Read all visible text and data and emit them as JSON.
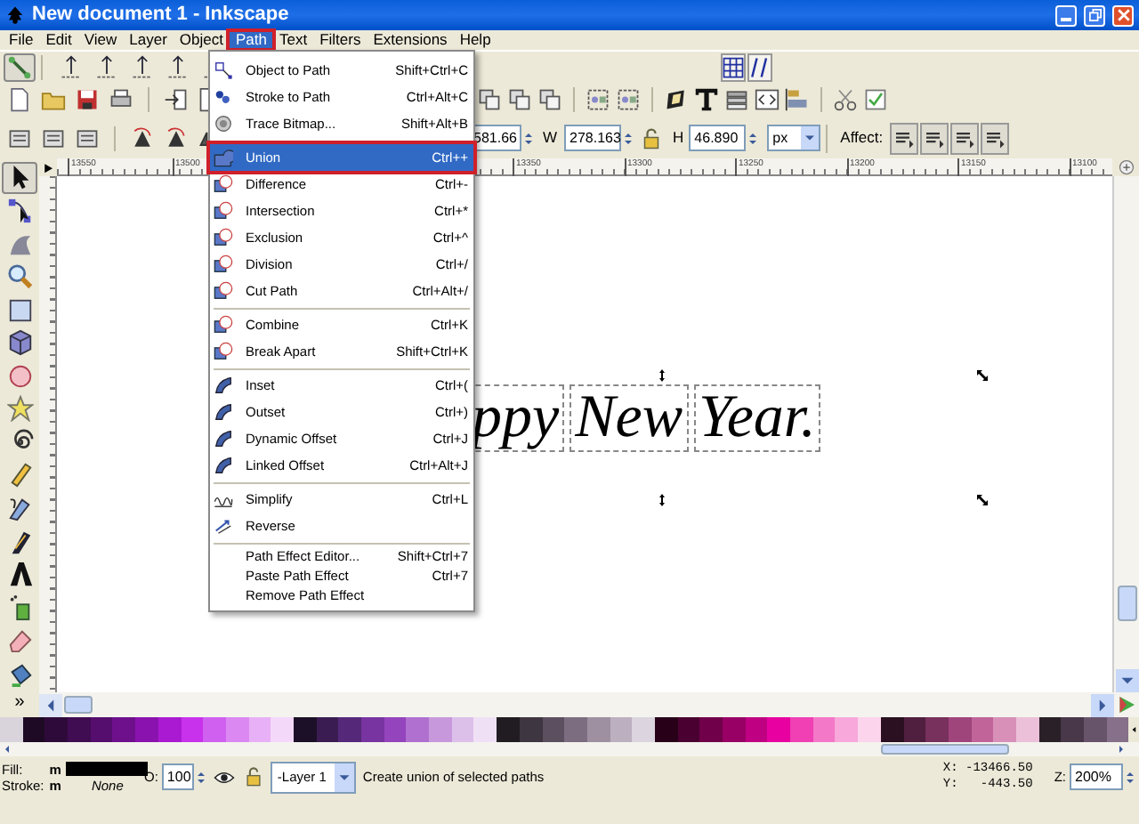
{
  "window": {
    "title": "New document 1 - Inkscape"
  },
  "menubar": [
    {
      "label": "File",
      "selected": false
    },
    {
      "label": "Edit",
      "selected": false
    },
    {
      "label": "View",
      "selected": false
    },
    {
      "label": "Layer",
      "selected": false
    },
    {
      "label": "Object",
      "selected": false
    },
    {
      "label": "Path",
      "selected": true
    },
    {
      "label": "Text",
      "selected": false
    },
    {
      "label": "Filters",
      "selected": false
    },
    {
      "label": "Extensions",
      "selected": false
    },
    {
      "label": "Help",
      "selected": false
    }
  ],
  "snap_toolbar": {
    "snap_enabled": true
  },
  "tool_controls": {
    "x_value": "581.66",
    "w_label": "W",
    "w_value": "278.163",
    "h_label": "H",
    "h_value": "46.890",
    "unit": "px",
    "affect_label": "Affect:"
  },
  "toolbox": [
    {
      "selected": true
    },
    {
      "selected": false
    },
    {
      "selected": false
    },
    {
      "selected": false
    },
    {
      "selected": false
    },
    {
      "selected": false
    },
    {
      "selected": false
    },
    {
      "selected": false
    },
    {
      "selected": false
    },
    {
      "selected": false
    },
    {
      "selected": false
    },
    {
      "selected": false
    },
    {
      "selected": false
    },
    {
      "selected": false
    },
    {
      "selected": false
    },
    {
      "selected": false
    }
  ],
  "toolbox_more": "»",
  "ruler": {
    "labels": [
      "13550",
      "13500",
      "13350",
      "13300",
      "13250",
      "13200",
      "13150",
      "13100"
    ]
  },
  "canvas": {
    "words": [
      "ppy",
      "New",
      "Year."
    ]
  },
  "path_menu": {
    "sections": [
      [
        {
          "label": "Object to Path",
          "shortcut": "Shift+Ctrl+C",
          "selected": false
        },
        {
          "label": "Stroke to Path",
          "shortcut": "Ctrl+Alt+C",
          "selected": false
        },
        {
          "label": "Trace Bitmap...",
          "shortcut": "Shift+Alt+B",
          "selected": false
        }
      ],
      [
        {
          "label": "Union",
          "shortcut": "Ctrl++",
          "selected": true
        },
        {
          "label": "Difference",
          "shortcut": "Ctrl+-",
          "selected": false
        },
        {
          "label": "Intersection",
          "shortcut": "Ctrl+*",
          "selected": false
        },
        {
          "label": "Exclusion",
          "shortcut": "Ctrl+^",
          "selected": false
        },
        {
          "label": "Division",
          "shortcut": "Ctrl+/",
          "selected": false
        },
        {
          "label": "Cut Path",
          "shortcut": "Ctrl+Alt+/",
          "selected": false
        }
      ],
      [
        {
          "label": "Combine",
          "shortcut": "Ctrl+K",
          "selected": false
        },
        {
          "label": "Break Apart",
          "shortcut": "Shift+Ctrl+K",
          "selected": false
        }
      ],
      [
        {
          "label": "Inset",
          "shortcut": "Ctrl+(",
          "selected": false
        },
        {
          "label": "Outset",
          "shortcut": "Ctrl+)",
          "selected": false
        },
        {
          "label": "Dynamic Offset",
          "shortcut": "Ctrl+J",
          "selected": false
        },
        {
          "label": "Linked Offset",
          "shortcut": "Ctrl+Alt+J",
          "selected": false
        }
      ],
      [
        {
          "label": "Simplify",
          "shortcut": "Ctrl+L",
          "selected": false
        },
        {
          "label": "Reverse",
          "selected": false
        }
      ],
      [
        {
          "label": "Path Effect Editor...",
          "shortcut": "Shift+Ctrl+7",
          "selected": false
        },
        {
          "label": "Paste Path Effect",
          "shortcut": "Ctrl+7",
          "selected": false
        },
        {
          "label": "Remove Path Effect",
          "selected": false
        }
      ]
    ]
  },
  "palette": [
    {
      "color": "#d9d3dc"
    },
    {
      "color": "#1e0a24"
    },
    {
      "color": "#2e0a3a"
    },
    {
      "color": "#400c52"
    },
    {
      "color": "#560e6e"
    },
    {
      "color": "#6e108c"
    },
    {
      "color": "#8a12ae"
    },
    {
      "color": "#aa1ad2"
    },
    {
      "color": "#c832ec"
    },
    {
      "color": "#d060f0"
    },
    {
      "color": "#dc88f2"
    },
    {
      "color": "#e8b0f6"
    },
    {
      "color": "#f4d8fa"
    },
    {
      "color": "#1c1028"
    },
    {
      "color": "#3a1c52"
    },
    {
      "color": "#56287a"
    },
    {
      "color": "#7834a0"
    },
    {
      "color": "#9444bc"
    },
    {
      "color": "#b070d0"
    },
    {
      "color": "#c898dc"
    },
    {
      "color": "#dcc0ea"
    },
    {
      "color": "#f0e0f6"
    },
    {
      "color": "#201c22"
    },
    {
      "color": "#3e3640"
    },
    {
      "color": "#5c5060"
    },
    {
      "color": "#7c6e80"
    },
    {
      "color": "#9e90a0"
    },
    {
      "color": "#bcb0c0"
    },
    {
      "color": "#dcd4de"
    },
    {
      "color": "#280018"
    },
    {
      "color": "#4a0030"
    },
    {
      "color": "#70004a"
    },
    {
      "color": "#980066"
    },
    {
      "color": "#c00082"
    },
    {
      "color": "#e800a0"
    },
    {
      "color": "#f040b4"
    },
    {
      "color": "#f478c8"
    },
    {
      "color": "#f8a8da"
    },
    {
      "color": "#fcd4ec"
    },
    {
      "color": "#2a1020"
    },
    {
      "color": "#501e3e"
    },
    {
      "color": "#78305c"
    },
    {
      "color": "#a0447c"
    },
    {
      "color": "#c0649a"
    },
    {
      "color": "#d890b8"
    },
    {
      "color": "#ecc0d8"
    },
    {
      "color": "#2a2028"
    },
    {
      "color": "#48384a"
    },
    {
      "color": "#68546a"
    },
    {
      "color": "#86708a"
    }
  ],
  "status_bar": {
    "fill_label": "Fill:",
    "fill_m": "m",
    "stroke_label": "Stroke:",
    "stroke_m": "m",
    "stroke_value": "None",
    "opacity_label": "O:",
    "opacity_value": "100",
    "layer": "-Layer 1",
    "message": "Create union of selected paths",
    "x_coord": "X: -13466.50",
    "y_coord": "Y:   -443.50",
    "zoom_label": "Z:",
    "zoom_value": "200%"
  }
}
